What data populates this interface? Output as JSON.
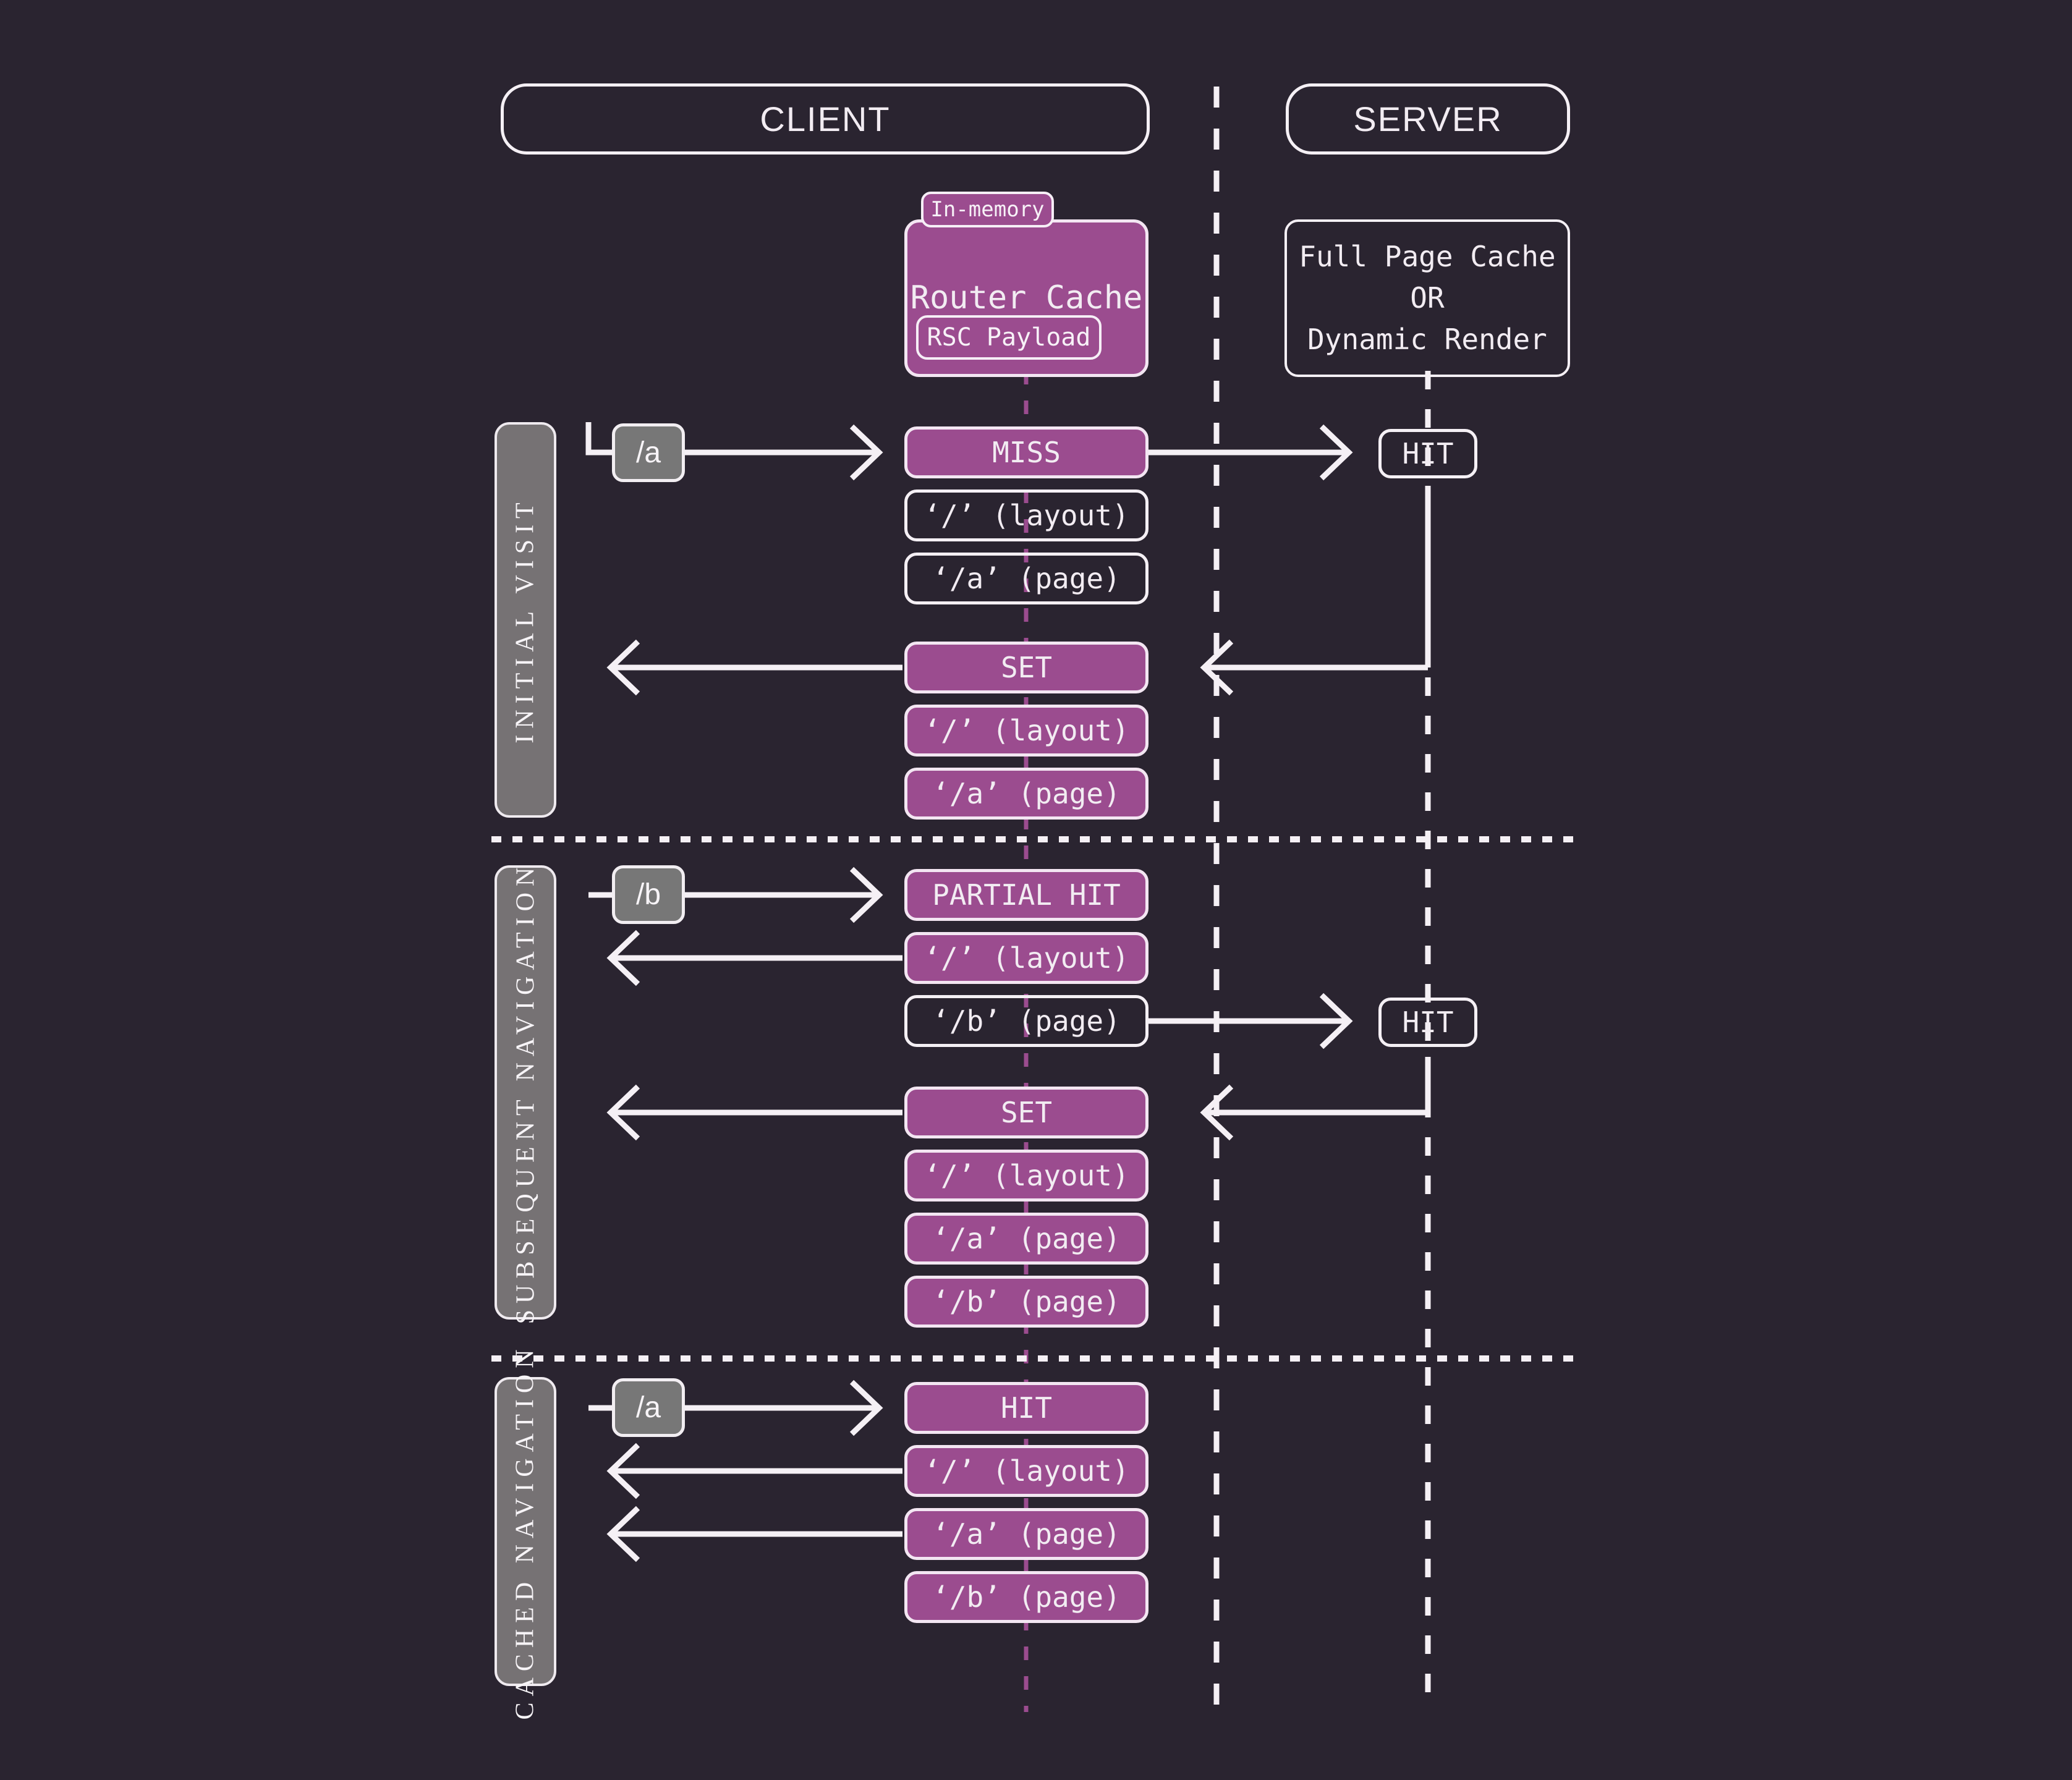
{
  "canvas": {
    "background": "#2a2430",
    "accent_purple": "#9b4c8f",
    "line_white": "#f5f0f5",
    "rail_gray": "#767274",
    "chip_gray": "#777777"
  },
  "actors": {
    "client": "CLIENT",
    "server": "SERVER"
  },
  "router_cache": {
    "tag": "In-memory",
    "title": "Router Cache",
    "payload": "RSC Payload"
  },
  "server_note": {
    "line1": "Full Page Cache",
    "line2": "OR",
    "line3": "Dynamic Render"
  },
  "phases": [
    {
      "label": "INITIAL VISIT"
    },
    {
      "label": "SUBSEQUENT NAVIGATION"
    },
    {
      "label": "CACHED NAVIGATION"
    }
  ],
  "sections": {
    "initial_visit": {
      "request": "/a",
      "client_boxes": [
        {
          "text": "MISS",
          "style": "purple"
        },
        {
          "text": "‘/’ (layout)",
          "style": "outline"
        },
        {
          "text": "‘/a’ (page)",
          "style": "outline"
        },
        {
          "text": "SET",
          "style": "purple"
        },
        {
          "text": "‘/’ (layout)",
          "style": "purple"
        },
        {
          "text": "‘/a’ (page)",
          "style": "purple"
        }
      ],
      "server_box": "HIT"
    },
    "subsequent_navigation": {
      "request": "/b",
      "client_boxes": [
        {
          "text": "PARTIAL HIT",
          "style": "purple"
        },
        {
          "text": "‘/’ (layout)",
          "style": "purple"
        },
        {
          "text": "‘/b’ (page)",
          "style": "outline"
        },
        {
          "text": "SET",
          "style": "purple"
        },
        {
          "text": "‘/’ (layout)",
          "style": "purple"
        },
        {
          "text": "‘/a’ (page)",
          "style": "purple"
        },
        {
          "text": "‘/b’ (page)",
          "style": "purple"
        }
      ],
      "server_box": "HIT"
    },
    "cached_navigation": {
      "request": "/a",
      "client_boxes": [
        {
          "text": "HIT",
          "style": "purple"
        },
        {
          "text": "‘/’ (layout)",
          "style": "purple"
        },
        {
          "text": "‘/a’ (page)",
          "style": "purple"
        },
        {
          "text": "‘/b’ (page)",
          "style": "purple"
        }
      ],
      "server_box": null
    }
  }
}
